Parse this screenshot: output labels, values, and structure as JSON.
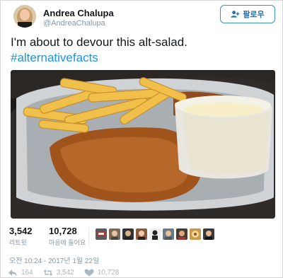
{
  "author": {
    "name": "Andrea Chalupa",
    "handle": "@AndreaChalupa"
  },
  "follow_button": {
    "label": "팔로우",
    "icon": "add-person-icon"
  },
  "tweet": {
    "text": "I'm about to devour this alt-salad.",
    "hashtag": "#alternativefacts"
  },
  "stats": {
    "retweets": {
      "value": "3,542",
      "label": "리트윗"
    },
    "likes": {
      "value": "10,728",
      "label": "마음에 들어요"
    }
  },
  "likers": [
    "liker-avatar-1",
    "liker-avatar-2",
    "liker-avatar-3",
    "liker-avatar-4",
    "liker-avatar-5",
    "liker-avatar-6",
    "liker-avatar-7",
    "liker-avatar-8",
    "liker-avatar-9"
  ],
  "timestamp": "오전 10:24 - 2017년 1월 22일",
  "actions": {
    "reply_count": "164",
    "retweet_count": "3,542",
    "like_count": "10,728"
  },
  "colors": {
    "link": "#1b95e0",
    "follow_border": "#3a8fd9",
    "muted": "#8899a6"
  }
}
